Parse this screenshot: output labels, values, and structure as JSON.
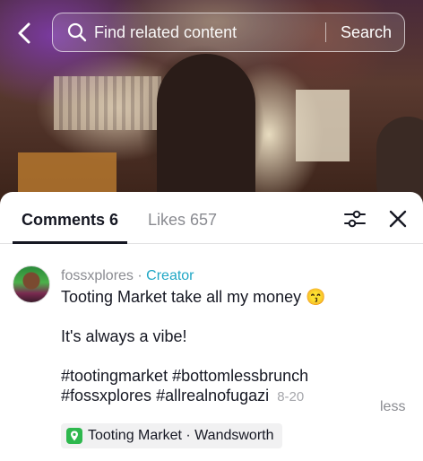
{
  "search": {
    "placeholder": "Find related content",
    "button_label": "Search"
  },
  "tabs": [
    {
      "label": "Comments 6",
      "active": true
    },
    {
      "label": "Likes 657",
      "active": false
    }
  ],
  "comment": {
    "username": "fossxplores",
    "separator": "·",
    "badge": "Creator",
    "line1": "Tooting Market take all my money",
    "emoji": "😙",
    "line2": "It's always a vibe!",
    "hashtags_line1": [
      "#tootingmarket",
      "#bottomlessbrunch"
    ],
    "hashtags_line2": [
      "#fossxplores",
      "#allrealnofugazi"
    ],
    "date": "8-20",
    "collapse_label": "less"
  },
  "location": {
    "label": "Tooting Market · Wandsworth",
    "icon": "location-pin-icon",
    "icon_color": "#2eb84e"
  },
  "icons": {
    "back": "chevron-left-icon",
    "search": "search-icon",
    "filter": "sliders-icon",
    "close": "close-icon"
  },
  "colors": {
    "creator_badge": "#20a7c5",
    "text_primary": "#161823",
    "text_secondary": "#8a8b91"
  }
}
